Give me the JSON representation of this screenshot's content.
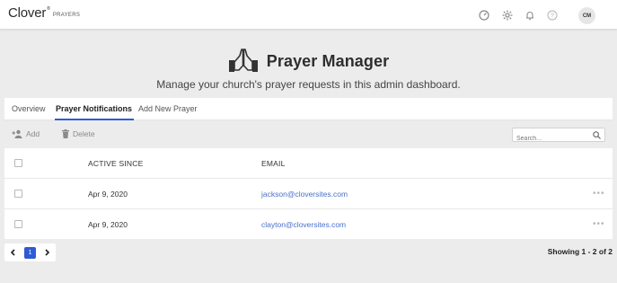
{
  "brand": {
    "name": "Clover",
    "registered": "®",
    "product": "PRAYERS"
  },
  "topbar": {
    "icons": [
      "dashboard-gauge-icon",
      "settings-gear-icon",
      "notification-bell-icon",
      "help-icon"
    ],
    "avatar_initials": "CM"
  },
  "header": {
    "title": "Prayer Manager",
    "subtitle": "Manage your church's prayer requests in this admin dashboard."
  },
  "tabs": [
    {
      "label": "Overview",
      "active": false
    },
    {
      "label": "Prayer Notifications",
      "active": true
    },
    {
      "label": "Add New Prayer",
      "active": false
    }
  ],
  "toolbar": {
    "add_label": "Add",
    "delete_label": "Delete",
    "search_placeholder": "Search..."
  },
  "table": {
    "columns": [
      "ACTIVE SINCE",
      "EMAIL"
    ],
    "rows": [
      {
        "active_since": "Apr 9, 2020",
        "email": "jackson@cloversites.com"
      },
      {
        "active_since": "Apr 9, 2020",
        "email": "clayton@cloversites.com"
      }
    ]
  },
  "pagination": {
    "current_page": "1",
    "showing_text": "Showing 1 - 2 of 2"
  },
  "colors": {
    "accent": "#2e5bd6",
    "link": "#4a6fc9",
    "background": "#ececec"
  }
}
